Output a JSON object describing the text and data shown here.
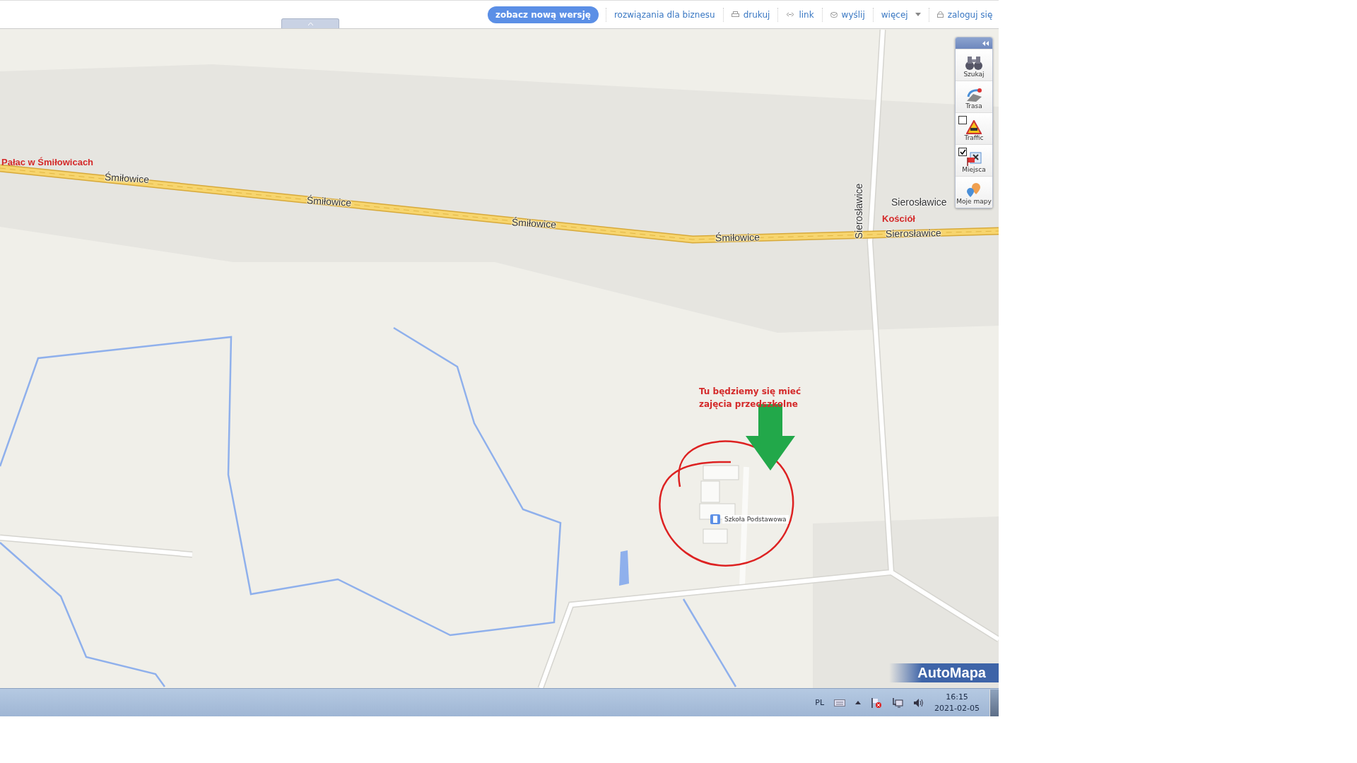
{
  "top_bar": {
    "new_version_button": "zobacz nową wersję",
    "links": [
      {
        "label": "rozwiązania dla biznesu",
        "kind": "plain"
      },
      {
        "label": "drukuj",
        "kind": "print"
      },
      {
        "label": "link",
        "kind": "link"
      },
      {
        "label": "wyślij",
        "kind": "mail"
      },
      {
        "label": "więcej",
        "kind": "dropdown"
      },
      {
        "label": "zaloguj się",
        "kind": "login"
      }
    ]
  },
  "map": {
    "labels": [
      {
        "text": "Pałac w Śmiłowicach",
        "kind": "landmark"
      },
      {
        "text": "Śmiłowice",
        "kind": "road"
      },
      {
        "text": "Śmiłowice",
        "kind": "road"
      },
      {
        "text": "Śmiłowice",
        "kind": "road"
      },
      {
        "text": "Śmiłowice",
        "kind": "road"
      },
      {
        "text": "Sierosławice",
        "kind": "road-vertical"
      },
      {
        "text": "Sierosławice",
        "kind": "place"
      },
      {
        "text": "Kościół",
        "kind": "landmark"
      },
      {
        "text": "Sierosławice",
        "kind": "road"
      }
    ],
    "poi": {
      "label": "Szkoła Podstawowa"
    },
    "annotation": "Tu będziemy się mieć zajęcia przedszkolne",
    "logo": "AutoMapa"
  },
  "toolbar": {
    "items": [
      {
        "label": "Szukaj",
        "kind": "search"
      },
      {
        "label": "Trasa",
        "kind": "route"
      },
      {
        "label": "Traffic",
        "kind": "traffic",
        "checked": false
      },
      {
        "label": "Miejsca",
        "kind": "places",
        "checked": true
      },
      {
        "label": "Moje mapy",
        "kind": "mymaps"
      }
    ]
  },
  "taskbar": {
    "language": "PL",
    "time": "16:15",
    "date": "2021-02-05"
  }
}
